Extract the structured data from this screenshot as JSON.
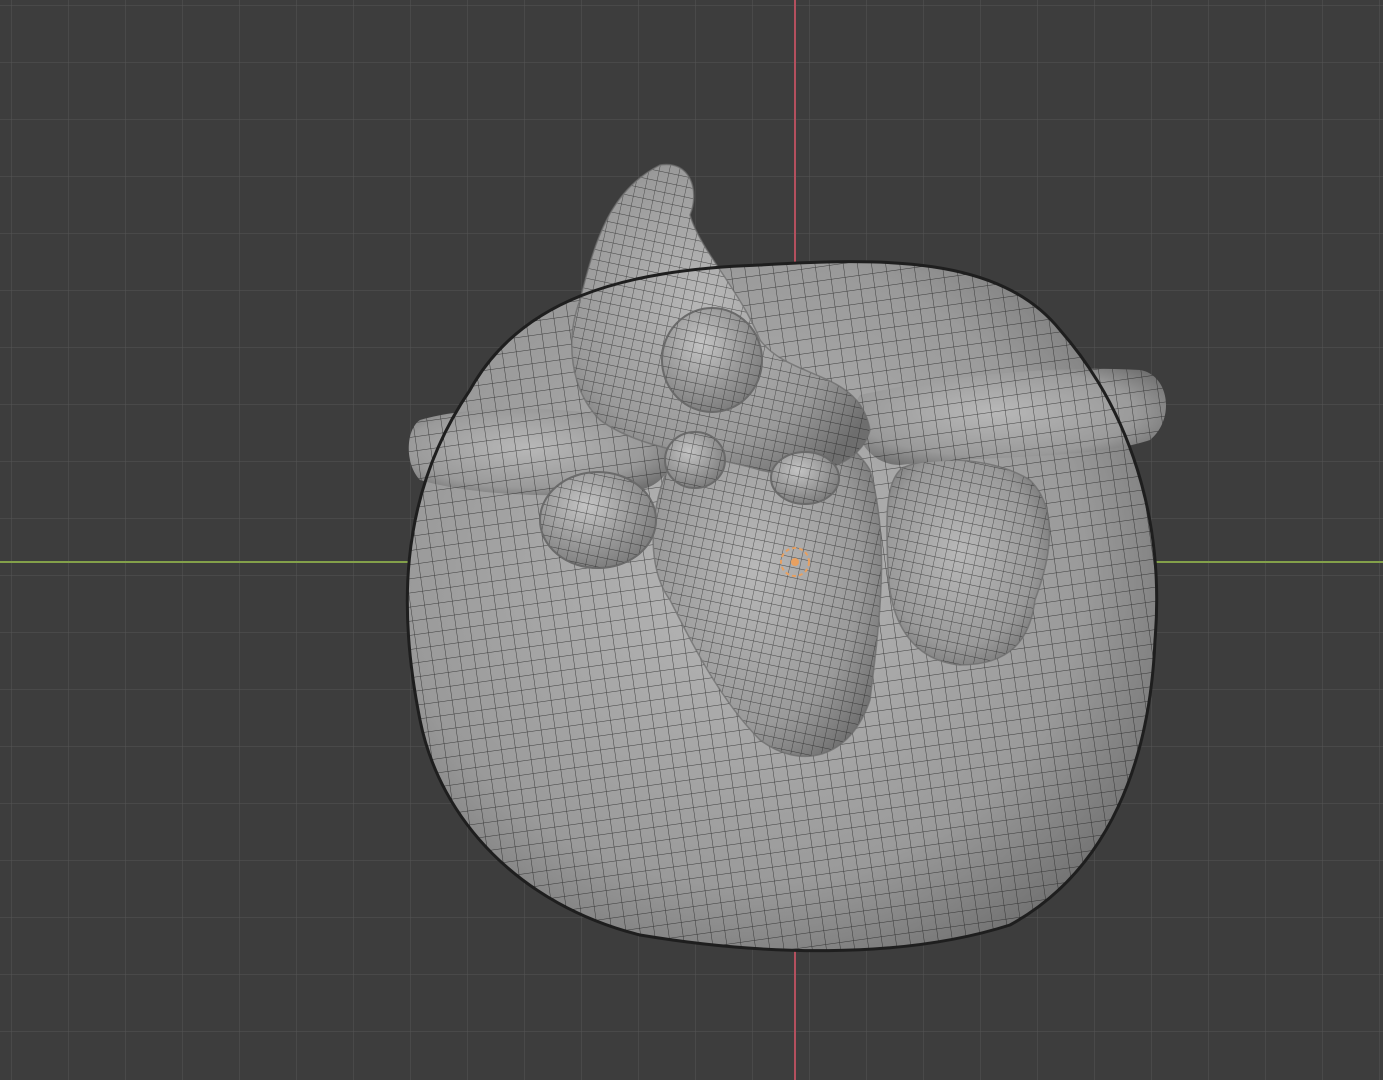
{
  "viewport": {
    "background": "#3d3d3d",
    "grid_minor_color": "#474747",
    "grid_major_color": "#555555",
    "x_axis_color": "#83a04a",
    "y_axis_color": "#b4505e"
  },
  "mesh": {
    "surface_color": "#a8a8a8",
    "wire_color": "#1e1e1e",
    "shadow_color": "#6a6a6a"
  },
  "origin_marker": {
    "color": "#e8a060",
    "icon": "object-origin-icon"
  }
}
